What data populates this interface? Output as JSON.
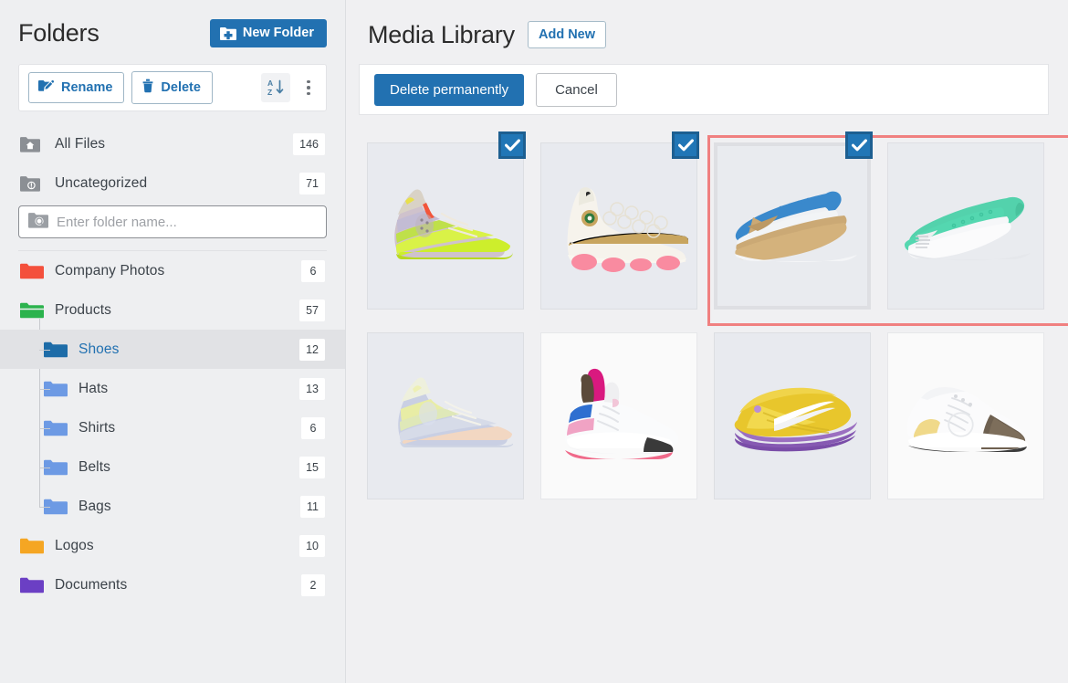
{
  "sidebar": {
    "title": "Folders",
    "new_folder_label": "New Folder",
    "toolbar": {
      "rename_label": "Rename",
      "delete_label": "Delete",
      "sort_icon": "sort-az-icon",
      "more_icon": "more-vertical-icon"
    },
    "system_items": [
      {
        "label": "All Files",
        "count": "146",
        "icon": "home-folder-icon"
      },
      {
        "label": "Uncategorized",
        "count": "71",
        "icon": "uncategorized-folder-icon"
      }
    ],
    "search": {
      "placeholder": "Enter folder name...",
      "value": "",
      "icon": "folder-search-icon"
    },
    "folders": [
      {
        "label": "Company Photos",
        "count": "6",
        "color": "#f4503c",
        "level": 0,
        "selected": false,
        "expanded": false
      },
      {
        "label": "Products",
        "count": "57",
        "color": "#2bb34d",
        "level": 0,
        "selected": false,
        "expanded": true
      },
      {
        "label": "Shoes",
        "count": "12",
        "color": "#1d6ca8",
        "level": 1,
        "selected": true,
        "expanded": false
      },
      {
        "label": "Hats",
        "count": "13",
        "color": "#6d9ae4",
        "level": 1,
        "selected": false,
        "expanded": false
      },
      {
        "label": "Shirts",
        "count": "6",
        "color": "#6d9ae4",
        "level": 1,
        "selected": false,
        "expanded": false
      },
      {
        "label": "Belts",
        "count": "15",
        "color": "#6d9ae4",
        "level": 1,
        "selected": false,
        "expanded": false
      },
      {
        "label": "Bags",
        "count": "11",
        "color": "#6d9ae4",
        "level": 1,
        "selected": false,
        "expanded": false
      },
      {
        "label": "Logos",
        "count": "10",
        "color": "#f5a623",
        "level": 0,
        "selected": false,
        "expanded": false
      },
      {
        "label": "Documents",
        "count": "2",
        "color": "#6b3fc4",
        "level": 0,
        "selected": false,
        "expanded": false
      }
    ]
  },
  "main": {
    "title": "Media Library",
    "add_new_label": "Add New",
    "delete_permanently_label": "Delete permanently",
    "cancel_label": "Cancel",
    "media": [
      {
        "name": "kd12-multicolor-sneaker",
        "selected": true,
        "active": false,
        "bg": "plain"
      },
      {
        "name": "jordan13-gold-pink-sneaker",
        "selected": true,
        "active": false,
        "bg": "plain"
      },
      {
        "name": "metcon-blue-tan-sneaker",
        "selected": true,
        "active": true,
        "bg": "plain"
      },
      {
        "name": "metcon-mint-green-sneaker",
        "selected": false,
        "active": false,
        "bg": "plain"
      },
      {
        "name": "kd12-pastel-sneaker",
        "selected": false,
        "active": false,
        "bg": "plain"
      },
      {
        "name": "lv-archlight-pink-blue-sneaker",
        "selected": false,
        "active": false,
        "bg": "white"
      },
      {
        "name": "kd-yellow-purple-sneaker",
        "selected": false,
        "active": false,
        "bg": "plain"
      },
      {
        "name": "lv-runaway-white-brown-sneaker",
        "selected": false,
        "active": false,
        "bg": "white"
      }
    ]
  },
  "colors": {
    "accent": "#2271b1",
    "selection_frame": "#f08080",
    "active_tile_border": "#4088c9",
    "checkbox_fill": "#2176b6",
    "checkbox_border": "#1d5f91",
    "page_bg": "#eeeff1"
  }
}
